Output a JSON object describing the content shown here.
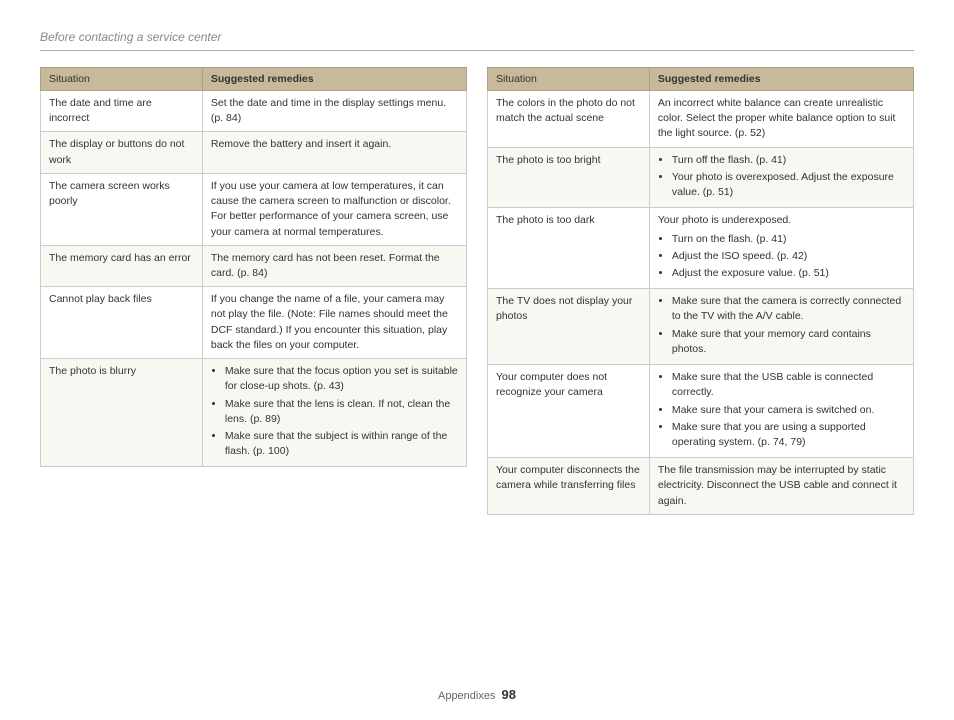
{
  "page": {
    "title": "Before contacting a service center",
    "footer_label": "Appendixes",
    "footer_number": "98"
  },
  "left_table": {
    "col_situation": "Situation",
    "col_remedies": "Suggested remedies",
    "rows": [
      {
        "situation": "The date and time are incorrect",
        "remedy_text": "Set the date and time in the display settings menu. (p. 84)",
        "remedy_list": []
      },
      {
        "situation": "The display or buttons do not work",
        "remedy_text": "Remove the battery and insert it again.",
        "remedy_list": []
      },
      {
        "situation": "The camera screen works poorly",
        "remedy_text": "If you use your camera at low temperatures, it can cause the camera screen to malfunction or discolor.\nFor better performance of your camera screen, use your camera at normal temperatures.",
        "remedy_list": []
      },
      {
        "situation": "The memory card has an error",
        "remedy_text": "The memory card has not been reset. Format the card. (p. 84)",
        "remedy_list": []
      },
      {
        "situation": "Cannot play back files",
        "remedy_text": "If you change the name of a file, your camera may not play the file. (Note: File names should meet the DCF standard.) If you encounter this situation, play back the files on your computer.",
        "remedy_list": []
      },
      {
        "situation": "The photo is blurry",
        "remedy_text": "",
        "remedy_list": [
          "Make sure that the focus option you set is suitable for close-up shots. (p. 43)",
          "Make sure that the lens is clean. If not, clean the lens. (p. 89)",
          "Make sure that the subject is within range of the flash. (p. 100)"
        ]
      }
    ]
  },
  "right_table": {
    "col_situation": "Situation",
    "col_remedies": "Suggested remedies",
    "rows": [
      {
        "situation": "The colors in the photo do not match the actual scene",
        "remedy_text": "An incorrect white balance can create unrealistic color. Select the proper white balance option to suit the light source. (p. 52)",
        "remedy_list": []
      },
      {
        "situation": "The photo is too bright",
        "remedy_text": "",
        "remedy_list": [
          "Turn off the flash. (p. 41)",
          "Your photo is overexposed. Adjust the exposure value. (p. 51)"
        ]
      },
      {
        "situation": "The photo is too dark",
        "remedy_text": "Your photo is underexposed.",
        "remedy_list": [
          "Turn on the flash. (p. 41)",
          "Adjust the ISO speed. (p. 42)",
          "Adjust the exposure value. (p. 51)"
        ]
      },
      {
        "situation": "The TV does not display your photos",
        "remedy_text": "",
        "remedy_list": [
          "Make sure that the camera is correctly connected to the TV with the A/V cable.",
          "Make sure that your memory card contains photos."
        ]
      },
      {
        "situation": "Your computer does not recognize your camera",
        "remedy_text": "",
        "remedy_list": [
          "Make sure that the USB cable is connected correctly.",
          "Make sure that your camera is switched on.",
          "Make sure that you are using a supported operating system. (p. 74, 79)"
        ]
      },
      {
        "situation": "Your computer disconnects the camera while transferring files",
        "remedy_text": "The file transmission may be interrupted by static electricity. Disconnect the USB cable and connect it again.",
        "remedy_list": []
      }
    ]
  }
}
